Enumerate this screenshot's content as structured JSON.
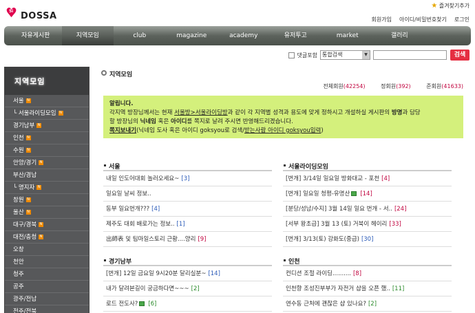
{
  "logo": {
    "mark": "5i",
    "name": "DOSSA"
  },
  "header": {
    "bookmark": "즐겨찾기추가",
    "links": [
      "회원가입",
      "아이디/비밀번호찾기",
      "로그인"
    ]
  },
  "nav": [
    "자유게시판",
    "지역모임",
    "club",
    "magazine",
    "academy",
    "유저투고",
    "market",
    "갤러리"
  ],
  "search": {
    "checkbox_label": "댓글포함",
    "scope": "통합검색",
    "button": "검색"
  },
  "sidebar": {
    "title": "지역모임",
    "items": [
      {
        "label": "서울",
        "badge": true
      },
      {
        "label": "└ 서울라이딩모임",
        "badge": true
      },
      {
        "label": "경기남부",
        "badge": true
      },
      {
        "label": "인천",
        "badge": true
      },
      {
        "label": "수원",
        "badge": true
      },
      {
        "label": "안양/경기",
        "badge": true
      },
      {
        "label": "부산/경남",
        "badge": false
      },
      {
        "label": "└ 명지자",
        "badge": true
      },
      {
        "label": "창원",
        "badge": true
      },
      {
        "label": "울산",
        "badge": true
      },
      {
        "label": "대구/경북",
        "badge": true
      },
      {
        "label": "대전/충청",
        "badge": true
      },
      {
        "label": "오창",
        "badge": false
      },
      {
        "label": "천안",
        "badge": false
      },
      {
        "label": "청주",
        "badge": false
      },
      {
        "label": "공주",
        "badge": false
      },
      {
        "label": "광주/전남",
        "badge": false
      },
      {
        "label": "전주/전북",
        "badge": false
      }
    ]
  },
  "page": {
    "title": "지역모임",
    "stats": [
      {
        "label": "전체회원",
        "value": "(42254)"
      },
      {
        "label": "정회원",
        "value": "(392)"
      },
      {
        "label": "준회원",
        "value": "(41633)"
      }
    ]
  },
  "notice": {
    "title": "알립니다.",
    "line1_a": "각지역 방장님께서는 현재 ",
    "line1_link": "서울방>서울라이딩방",
    "line1_b": "과 같이 각 지역별 성격과 용도에 맞게 정하시고 개설하실 게시판의 ",
    "line1_bold": "방명",
    "line1_c": "과 담당",
    "line2_a": "할 방장님의 ",
    "line2_bold1": "닉네임",
    "line2_b": " 혹은 ",
    "line2_bold2": "아이디",
    "line2_c": "를 쪽지로 날려 주시면 반영해드리겠습니다.",
    "line3_link": "쪽지보내기",
    "line3_a": "(닉네임 도사 혹은 아이디 goksyou로 검색/",
    "line3_link2": "받는사람 아이디 goksyou입력",
    "line3_b": ")"
  },
  "sections": [
    {
      "title": "서울",
      "posts": [
        {
          "text": "내일 인도어대회 놀러오세요~",
          "count": "[3]",
          "color": "blue",
          "img": false
        },
        {
          "text": "일요일 날씨 정보..",
          "count": "",
          "color": "blue",
          "img": false
        },
        {
          "text": "동부 일요번개???",
          "count": "[4]",
          "color": "blue",
          "img": false
        },
        {
          "text": "제주도 대회 배로가는 정보..",
          "count": "[1]",
          "color": "blue",
          "img": false
        },
        {
          "text": "出師表 및 팀마일스토리 근황....양리",
          "count": "[9]",
          "color": "red",
          "img": false
        }
      ]
    },
    {
      "title": "서울라이딩모임",
      "posts": [
        {
          "text": "[번개] 3/14일 일요일 방화대교 - 포천",
          "count": "[4]",
          "color": "red",
          "img": false
        },
        {
          "text": "[번개] 일요일 청평-유명산",
          "count": "[14]",
          "color": "red",
          "img": true
        },
        {
          "text": "[분당/성남/수지] 3월 14일 일요 번개 - 서..",
          "count": "[24]",
          "color": "red",
          "img": false
        },
        {
          "text": "[서부 왕초급] 3월 13 (토) 거북이 헤이리",
          "count": "[33]",
          "color": "red",
          "img": false
        },
        {
          "text": "[번개] 3/13(토) 강화도(중급)",
          "count": "[30]",
          "color": "blue",
          "img": false
        }
      ]
    },
    {
      "title": "경기남부",
      "posts": [
        {
          "text": "[번개] 12일 금요일 9시20분 달리실분~",
          "count": "[14]",
          "color": "blue",
          "img": false
        },
        {
          "text": "내가 달려본길이 궁금하다면~~~",
          "count": "[2]",
          "color": "green",
          "img": false
        },
        {
          "text": "로드 전도사?",
          "count": "[6]",
          "color": "green",
          "img": true
        }
      ]
    },
    {
      "title": "인천",
      "posts": [
        {
          "text": "컨디션 조절 라이딩..........",
          "count": "[8]",
          "color": "red",
          "img": false
        },
        {
          "text": "인천향 조성진부부가 자전거 샵을 오픈 했..",
          "count": "[11]",
          "color": "green",
          "img": false
        },
        {
          "text": "연수동 근처에 괜찮은 샵 있나요?",
          "count": "[2]",
          "color": "green",
          "img": false
        }
      ]
    }
  ]
}
